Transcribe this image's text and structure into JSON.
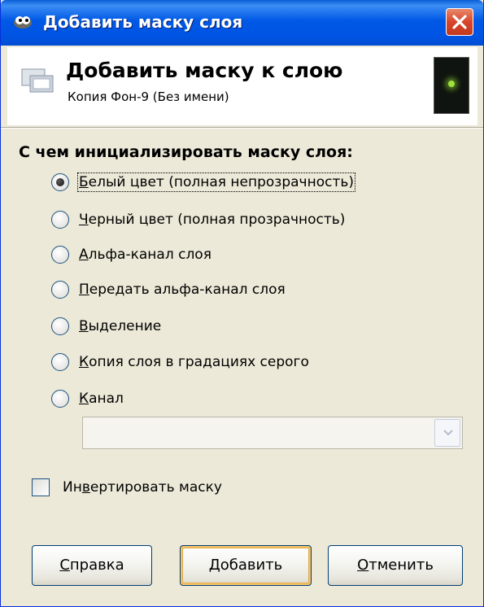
{
  "window": {
    "title": "Добавить маску слоя",
    "title_icon": "gimp-icon",
    "close_icon": "close-icon"
  },
  "header": {
    "title": "Добавить маску к слою",
    "subtitle": "Копия Фон-9 (Без имени)",
    "icon": "layer-mask-icon",
    "thumbnail": "layer-thumbnail"
  },
  "section": {
    "label": "С чем инициализировать маску слоя:"
  },
  "options": [
    {
      "mnemonic": "Б",
      "rest": "елый цвет (полная непрозрачность)",
      "checked": true
    },
    {
      "mnemonic": "Ч",
      "rest": "ерный цвет (полная прозрачность)",
      "checked": false
    },
    {
      "mnemonic": "А",
      "rest": "льфа-канал слоя",
      "checked": false
    },
    {
      "mnemonic": "П",
      "rest": "ередать альфа-канал слоя",
      "checked": false
    },
    {
      "mnemonic": "В",
      "rest": "ыделение",
      "checked": false
    },
    {
      "mnemonic": "К",
      "rest": "опия слоя в градациях серого",
      "checked": false
    },
    {
      "mnemonic": "К",
      "rest": "анал",
      "checked": false
    }
  ],
  "channel_combo": {
    "value": "",
    "disabled": true
  },
  "invert": {
    "label_pre": "Ин",
    "mnemonic": "в",
    "label_post": "ертировать маску",
    "checked": false
  },
  "buttons": {
    "help": {
      "mnemonic": "С",
      "rest": "правка"
    },
    "add": {
      "mnemonic": "Д",
      "rest": "обавить"
    },
    "cancel": {
      "mnemonic": "О",
      "rest": "тменить"
    }
  },
  "colors": {
    "titlebar": "#0054e3",
    "close": "#d8452a",
    "dialog_bg": "#ece9d8",
    "default_button_glow": "#f5c66b"
  }
}
